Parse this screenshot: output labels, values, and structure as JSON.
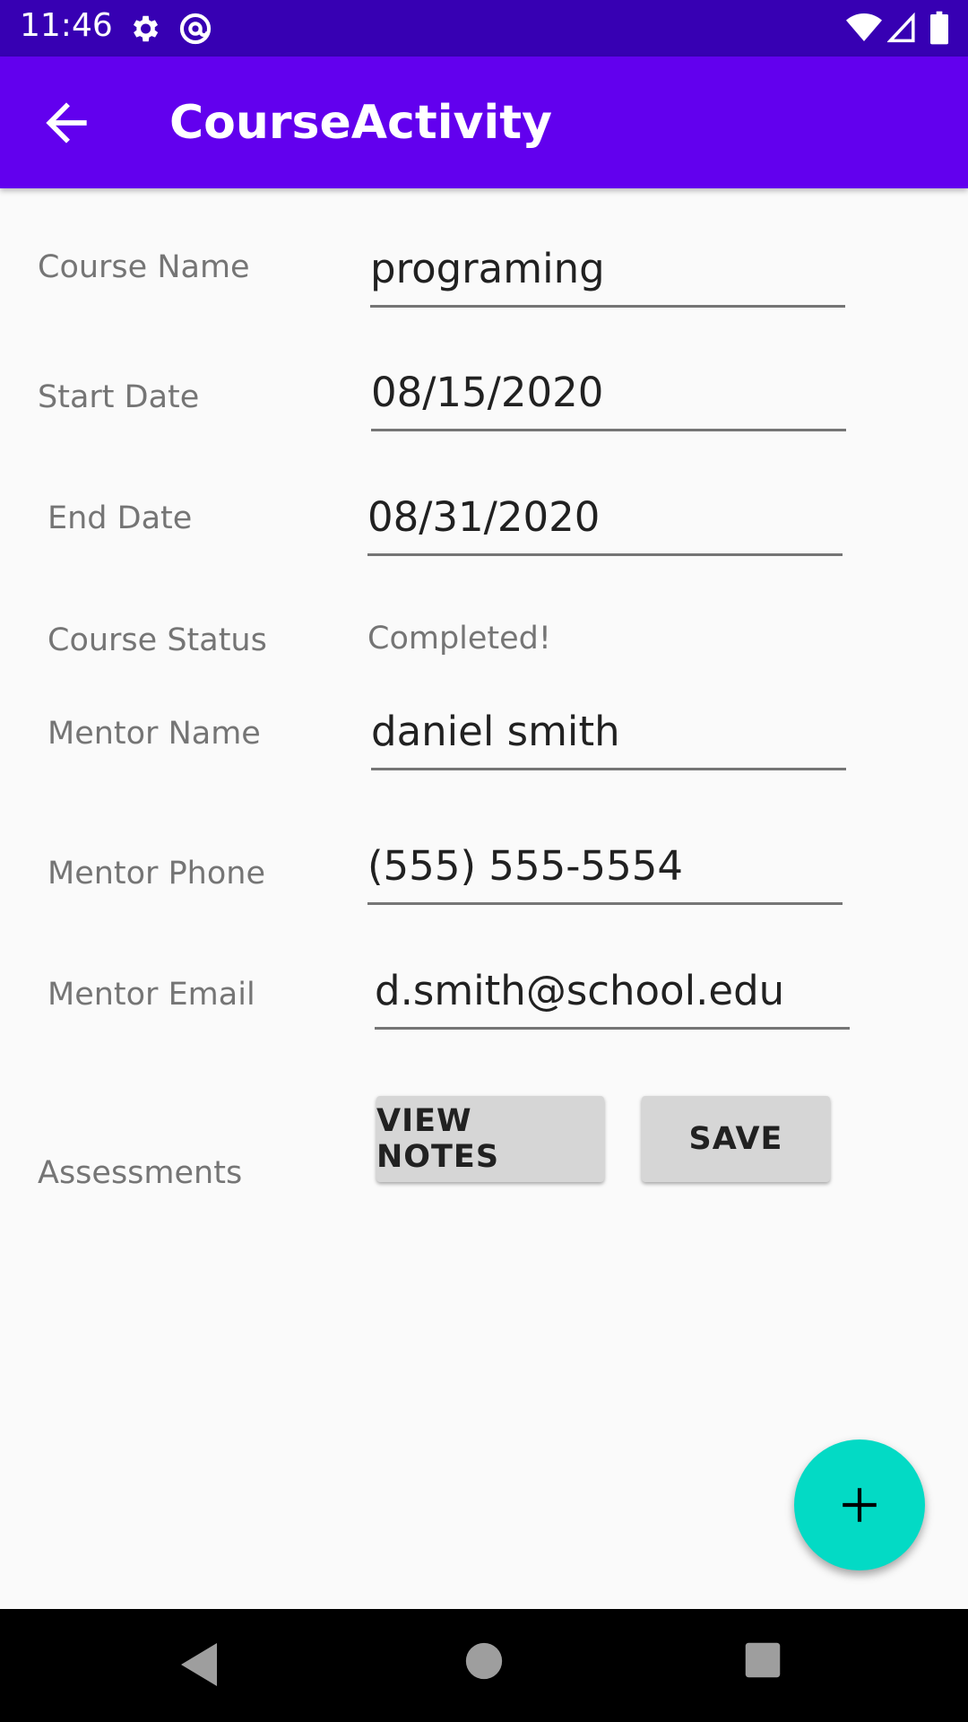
{
  "status_bar": {
    "time": "11:46"
  },
  "app_bar": {
    "title": "CourseActivity"
  },
  "form": {
    "course_name_label": "Course Name",
    "course_name_value": "programing",
    "start_date_label": "Start Date",
    "start_date_value": "08/15/2020",
    "end_date_label": "End Date",
    "end_date_value": "08/31/2020",
    "course_status_label": "Course Status",
    "course_status_value": "Completed!",
    "mentor_name_label": "Mentor Name",
    "mentor_name_value": "daniel smith",
    "mentor_phone_label": "Mentor Phone",
    "mentor_phone_value": "(555) 555-5554",
    "mentor_email_label": "Mentor Email",
    "mentor_email_value": "d.smith@school.edu"
  },
  "buttons": {
    "view_notes": "VIEW NOTES",
    "save": "SAVE"
  },
  "assessments_label": "Assessments",
  "icons": {
    "back": "arrow-left-icon",
    "fab": "plus-icon",
    "status": [
      "gear-icon",
      "at-sign-icon",
      "wifi-icon",
      "signal-icon",
      "battery-icon"
    ],
    "nav": [
      "back-triangle-icon",
      "home-circle-icon",
      "recents-square-icon"
    ]
  },
  "colors": {
    "primary": "#6200ee",
    "primary_dark": "#3700b3",
    "accent": "#03dac5"
  }
}
